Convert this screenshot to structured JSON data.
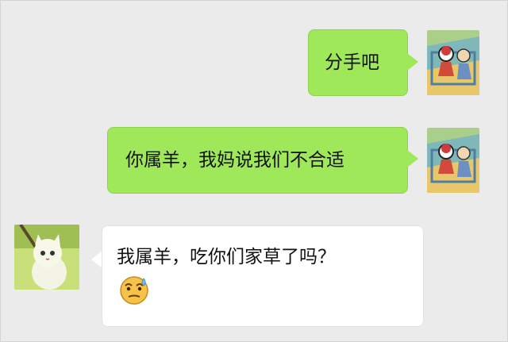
{
  "messages": [
    {
      "side": "right",
      "text": "分手吧"
    },
    {
      "side": "right",
      "text": "你属羊，我妈说我们不合适"
    },
    {
      "side": "left",
      "text": "我属羊，吃你们家草了吗？",
      "emoji": "sweat-smile-emoji"
    }
  ],
  "colors": {
    "background": "#ebebeb",
    "sent_bubble": "#9fe85a",
    "received_bubble": "#ffffff"
  },
  "icons": {
    "sender_avatar": "cartoon-avatar-icon",
    "receiver_avatar": "kitten-avatar-icon"
  }
}
